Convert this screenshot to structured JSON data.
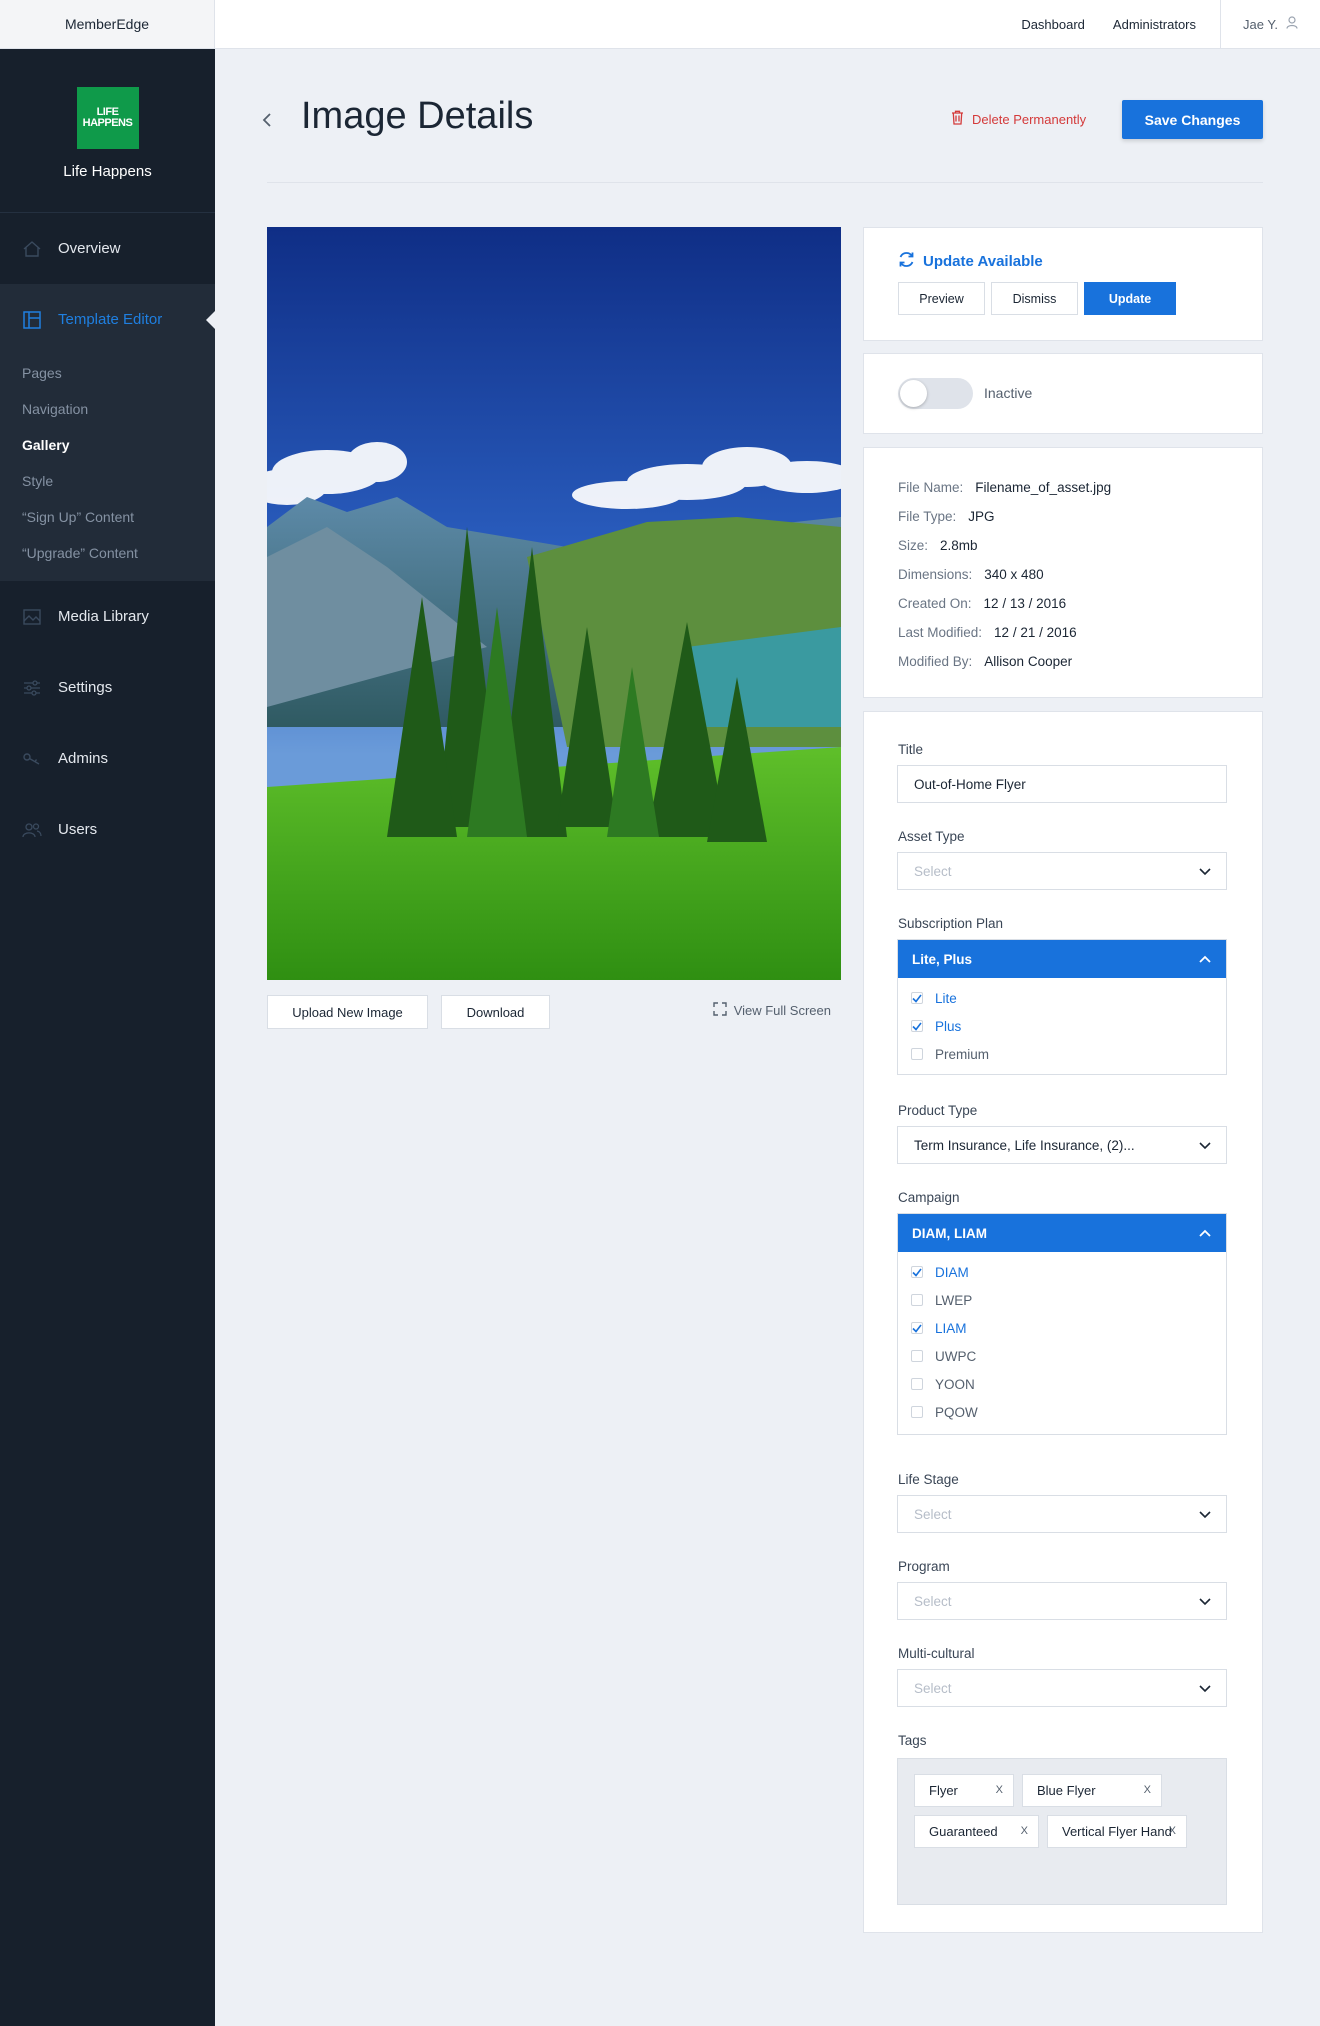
{
  "topbar": {
    "brand": "MemberEdge",
    "nav": [
      "Dashboard",
      "Administrators"
    ],
    "user": "Jae Y."
  },
  "sidebar": {
    "org_logo": [
      "LIFE",
      "HAPPENS"
    ],
    "org_name": "Life Happens",
    "items": [
      {
        "label": "Overview",
        "icon": "home-icon"
      },
      {
        "label": "Template Editor",
        "icon": "layout-icon"
      },
      {
        "label": "Media Library",
        "icon": "image-icon"
      },
      {
        "label": "Settings",
        "icon": "sliders-icon"
      },
      {
        "label": "Admins",
        "icon": "key-icon"
      },
      {
        "label": "Users",
        "icon": "users-icon"
      }
    ],
    "sub_items": [
      "Pages",
      "Navigation",
      "Gallery",
      "Style",
      "“Sign Up” Content",
      "“Upgrade” Content"
    ],
    "active_sub": "Gallery"
  },
  "header": {
    "title": "Image Details",
    "delete_label": "Delete Permanently",
    "save_label": "Save Changes"
  },
  "image_actions": {
    "upload": "Upload New Image",
    "download": "Download",
    "fullscreen": "View Full Screen"
  },
  "update": {
    "title": "Update Available",
    "preview": "Preview",
    "dismiss": "Dismiss",
    "update": "Update"
  },
  "status": {
    "label": "Inactive",
    "active": false
  },
  "meta": [
    {
      "key": "File Name:",
      "value": "Filename_of_asset.jpg"
    },
    {
      "key": "File Type:",
      "value": "JPG"
    },
    {
      "key": "Size:",
      "value": "2.8mb"
    },
    {
      "key": "Dimensions:",
      "value": "340 x 480"
    },
    {
      "key": "Created On:",
      "value": "12 / 13 / 2016"
    },
    {
      "key": "Last Modified:",
      "value": "12 / 21 / 2016"
    },
    {
      "key": "Modified By:",
      "value": "Allison Cooper"
    }
  ],
  "form": {
    "title_label": "Title",
    "title_value": "Out-of-Home Flyer",
    "asset_type_label": "Asset Type",
    "asset_type_value": "Select",
    "subscription_label": "Subscription Plan",
    "subscription_value": "Lite, Plus",
    "subscription_options": [
      {
        "label": "Lite",
        "checked": true
      },
      {
        "label": "Plus",
        "checked": true
      },
      {
        "label": "Premium",
        "checked": false
      }
    ],
    "product_label": "Product Type",
    "product_value": "Term Insurance, Life Insurance, (2)...",
    "campaign_label": "Campaign",
    "campaign_value": "DIAM, LIAM",
    "campaign_options": [
      {
        "label": "DIAM",
        "checked": true
      },
      {
        "label": "LWEP",
        "checked": false
      },
      {
        "label": "LIAM",
        "checked": true
      },
      {
        "label": "UWPC",
        "checked": false
      },
      {
        "label": "YOON",
        "checked": false
      },
      {
        "label": "PQOW",
        "checked": false
      }
    ],
    "life_stage_label": "Life Stage",
    "life_stage_value": "Select",
    "program_label": "Program",
    "program_value": "Select",
    "multicultural_label": "Multi-cultural",
    "multicultural_value": "Select",
    "tags_label": "Tags",
    "tags": [
      "Flyer",
      "Blue Flyer",
      "Guaranteed",
      "Vertical Flyer Hand"
    ],
    "tag_remove": "X"
  },
  "colors": {
    "accent": "#1872dc",
    "sidebar": "#17202c",
    "danger": "#d43a3a",
    "logo": "#0f9a4a"
  }
}
